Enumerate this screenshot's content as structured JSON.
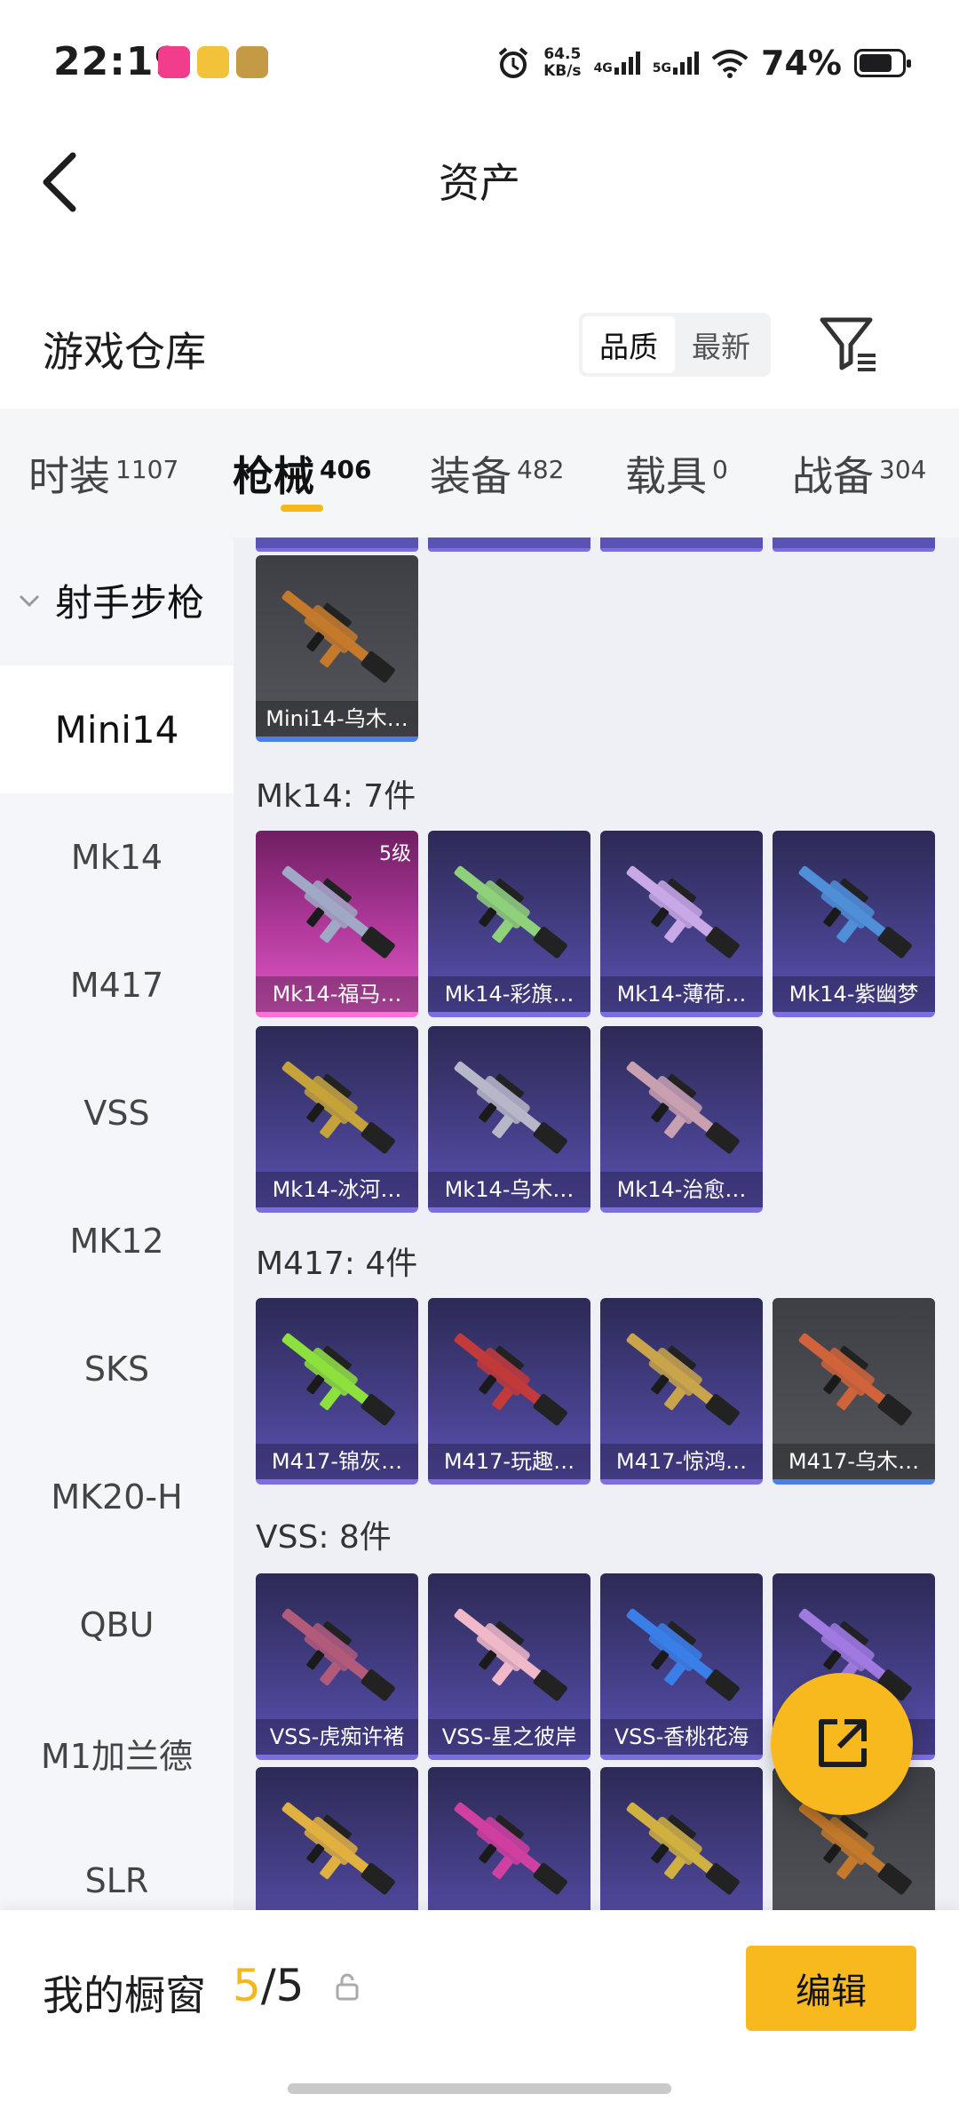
{
  "status_bar": {
    "time": "22:19",
    "net_speed_value": "64.5",
    "net_speed_unit": "KB/s",
    "net_4g": "4G",
    "net_5g": "5G",
    "battery": "74%",
    "icons": [
      "app-icon-pink",
      "app-icon-yellow",
      "app-icon-game",
      "alarm-icon",
      "signal-icon",
      "wifi-icon",
      "battery-icon"
    ]
  },
  "header": {
    "title": "资产"
  },
  "warehouse": {
    "title": "游戏仓库",
    "sort_options": [
      "品质",
      "最新"
    ],
    "sort_selected": "品质"
  },
  "tabs": [
    {
      "label": "时装",
      "count": "1107"
    },
    {
      "label": "枪械",
      "count": "406"
    },
    {
      "label": "装备",
      "count": "482"
    },
    {
      "label": "载具",
      "count": "0"
    },
    {
      "label": "战备",
      "count": "304"
    }
  ],
  "active_tab": "枪械",
  "sidebar": {
    "category": "射手步枪",
    "items": [
      "Mini14",
      "Mk14",
      "M417",
      "VSS",
      "MK12",
      "SKS",
      "MK20-H",
      "QBU",
      "M1加兰德",
      "SLR"
    ],
    "active": "Mini14"
  },
  "groups": [
    {
      "title": "",
      "items": [
        {
          "label": "Mini14-乌木…",
          "rarity": "gray"
        }
      ]
    },
    {
      "title": "Mk14: 7件",
      "items": [
        {
          "label": "Mk14-福马…",
          "rarity": "pink",
          "level": "5级"
        },
        {
          "label": "Mk14-彩旗…",
          "rarity": "purple"
        },
        {
          "label": "Mk14-薄荷…",
          "rarity": "purple"
        },
        {
          "label": "Mk14-紫幽梦",
          "rarity": "purple"
        },
        {
          "label": "Mk14-冰河…",
          "rarity": "purple"
        },
        {
          "label": "Mk14-乌木…",
          "rarity": "purple"
        },
        {
          "label": "Mk14-治愈…",
          "rarity": "purple"
        }
      ]
    },
    {
      "title": "M417: 4件",
      "items": [
        {
          "label": "M417-锦灰…",
          "rarity": "purple"
        },
        {
          "label": "M417-玩趣…",
          "rarity": "purple"
        },
        {
          "label": "M417-惊鸿…",
          "rarity": "purple"
        },
        {
          "label": "M417-乌木…",
          "rarity": "gray"
        }
      ]
    },
    {
      "title": "VSS: 8件",
      "items": [
        {
          "label": "VSS-虎痴许褚",
          "rarity": "purple"
        },
        {
          "label": "VSS-星之彼岸",
          "rarity": "purple"
        },
        {
          "label": "VSS-香桃花海",
          "rarity": "purple"
        },
        {
          "label": "号",
          "rarity": "purple"
        },
        {
          "label": "",
          "rarity": "purple"
        },
        {
          "label": "",
          "rarity": "purple"
        },
        {
          "label": "",
          "rarity": "purple"
        },
        {
          "label": "",
          "rarity": "gray"
        }
      ]
    }
  ],
  "showcase": {
    "title": "我的橱窗",
    "current": "5",
    "separator": "/",
    "total": "5",
    "edit_label": "编辑"
  },
  "colors": {
    "accent": "#f8b91e",
    "purple_rarity": "#5a52b4",
    "pink_rarity": "#e059c6",
    "gray_rarity": "#55565c"
  }
}
